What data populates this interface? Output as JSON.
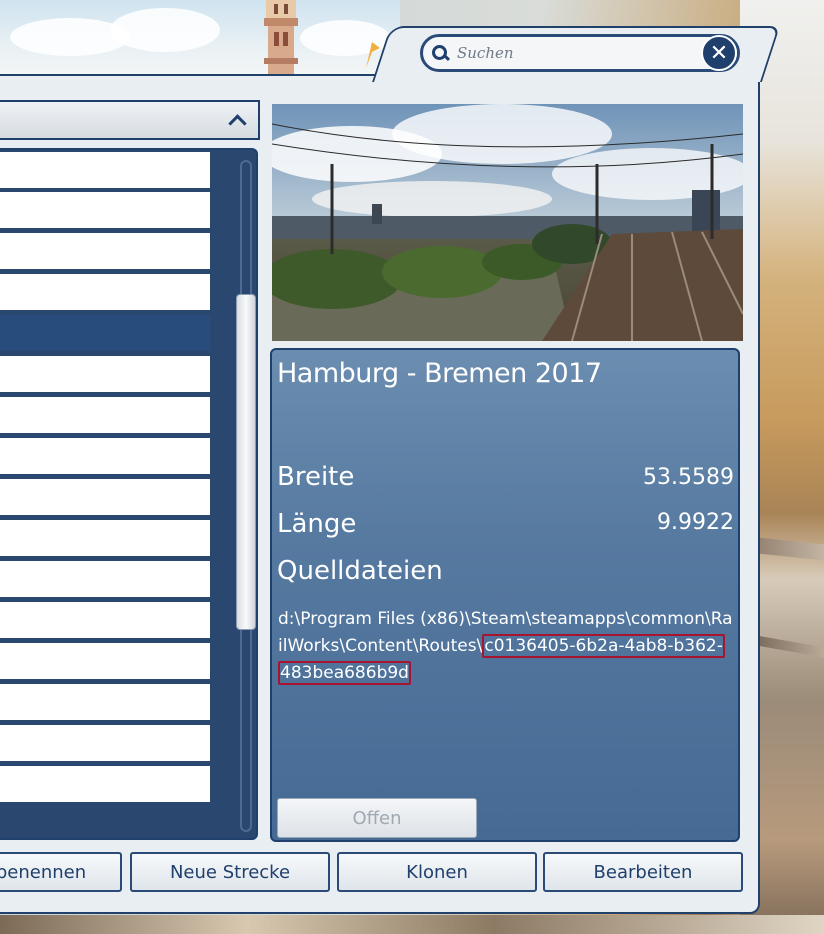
{
  "search": {
    "placeholder": "Suchen",
    "clear_icon": "close-icon"
  },
  "list": {
    "sort_icon": "chevron-up-icon",
    "row_count": 16,
    "selected_index": 4
  },
  "details": {
    "title": "Hamburg - Bremen 2017",
    "breite_label": "Breite",
    "breite_value": "53.5589",
    "laenge_label": "Länge",
    "laenge_value": "9.9922",
    "quelldateien_label": "Quelldateien",
    "path_prefix": "d:\\Program Files (x86)\\Steam\\steamapps\\common\\RailWorks\\Content\\Routes\\",
    "path_guid_part1": "c0136405-6b2a-4ab8-b362-",
    "path_guid_part2": "483bea686b9d",
    "open_button": "Offen"
  },
  "buttons": {
    "rename": "benennen",
    "new_route": "Neue Strecke",
    "clone": "Klonen",
    "edit": "Bearbeiten"
  },
  "colors": {
    "accent": "#1f3f6c",
    "selected_row": "#284c7c",
    "highlight": "#a81430"
  }
}
